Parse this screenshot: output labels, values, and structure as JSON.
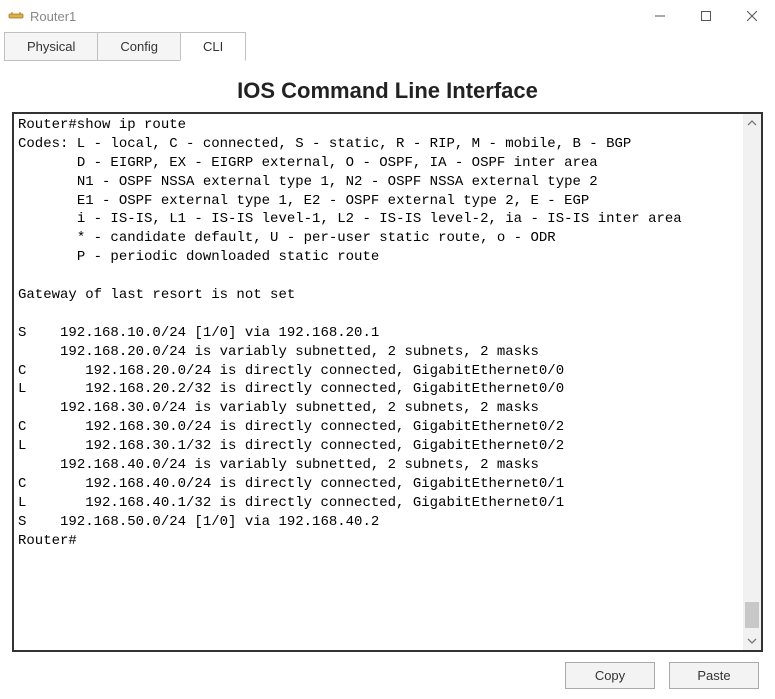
{
  "window": {
    "title": "Router1"
  },
  "tabs": [
    {
      "label": "Physical"
    },
    {
      "label": "Config"
    },
    {
      "label": "CLI"
    }
  ],
  "heading": "IOS Command Line Interface",
  "terminal": {
    "lines": [
      "Router#show ip route",
      "Codes: L - local, C - connected, S - static, R - RIP, M - mobile, B - BGP",
      "       D - EIGRP, EX - EIGRP external, O - OSPF, IA - OSPF inter area",
      "       N1 - OSPF NSSA external type 1, N2 - OSPF NSSA external type 2",
      "       E1 - OSPF external type 1, E2 - OSPF external type 2, E - EGP",
      "       i - IS-IS, L1 - IS-IS level-1, L2 - IS-IS level-2, ia - IS-IS inter area",
      "       * - candidate default, U - per-user static route, o - ODR",
      "       P - periodic downloaded static route",
      "",
      "Gateway of last resort is not set",
      "",
      "S    192.168.10.0/24 [1/0] via 192.168.20.1",
      "     192.168.20.0/24 is variably subnetted, 2 subnets, 2 masks",
      "C       192.168.20.0/24 is directly connected, GigabitEthernet0/0",
      "L       192.168.20.2/32 is directly connected, GigabitEthernet0/0",
      "     192.168.30.0/24 is variably subnetted, 2 subnets, 2 masks",
      "C       192.168.30.0/24 is directly connected, GigabitEthernet0/2",
      "L       192.168.30.1/32 is directly connected, GigabitEthernet0/2",
      "     192.168.40.0/24 is variably subnetted, 2 subnets, 2 masks",
      "C       192.168.40.0/24 is directly connected, GigabitEthernet0/1",
      "L       192.168.40.1/32 is directly connected, GigabitEthernet0/1",
      "S    192.168.50.0/24 [1/0] via 192.168.40.2",
      "Router#"
    ]
  },
  "buttons": {
    "copy": "Copy",
    "paste": "Paste"
  }
}
